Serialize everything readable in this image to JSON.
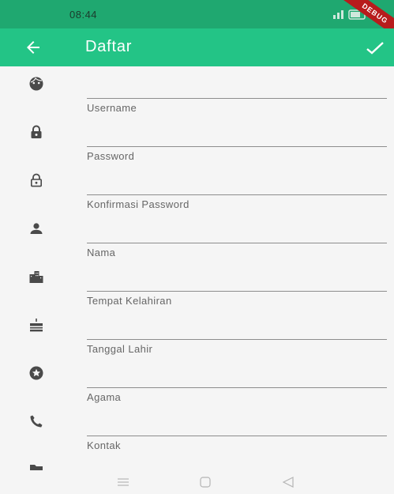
{
  "status_bar": {
    "time": "08:44",
    "debug_banner": "DEBUG",
    "icons": [
      "signal-icon",
      "battery-icon"
    ]
  },
  "app_bar": {
    "title": "Daftar",
    "back_icon": "arrow-back-icon",
    "confirm_icon": "check-icon",
    "color": "#23c486"
  },
  "form": {
    "fields": [
      {
        "icon": "face-icon",
        "label": "Username",
        "value": ""
      },
      {
        "icon": "lock-icon",
        "label": "Password",
        "value": ""
      },
      {
        "icon": "lock-outline-icon",
        "label": "Konfirmasi Password",
        "value": ""
      },
      {
        "icon": "person-icon",
        "label": "Nama",
        "value": ""
      },
      {
        "icon": "location-city-icon",
        "label": "Tempat Kelahiran",
        "value": ""
      },
      {
        "icon": "cake-icon",
        "label": "Tanggal Lahir",
        "value": ""
      },
      {
        "icon": "stars-icon",
        "label": "Agama",
        "value": ""
      },
      {
        "icon": "phone-icon",
        "label": "Kontak",
        "value": ""
      },
      {
        "icon": "folder-icon",
        "label": "",
        "value": ""
      }
    ]
  },
  "nav_bar": {
    "icons": [
      "recent-apps-icon",
      "home-icon",
      "back-icon"
    ]
  }
}
